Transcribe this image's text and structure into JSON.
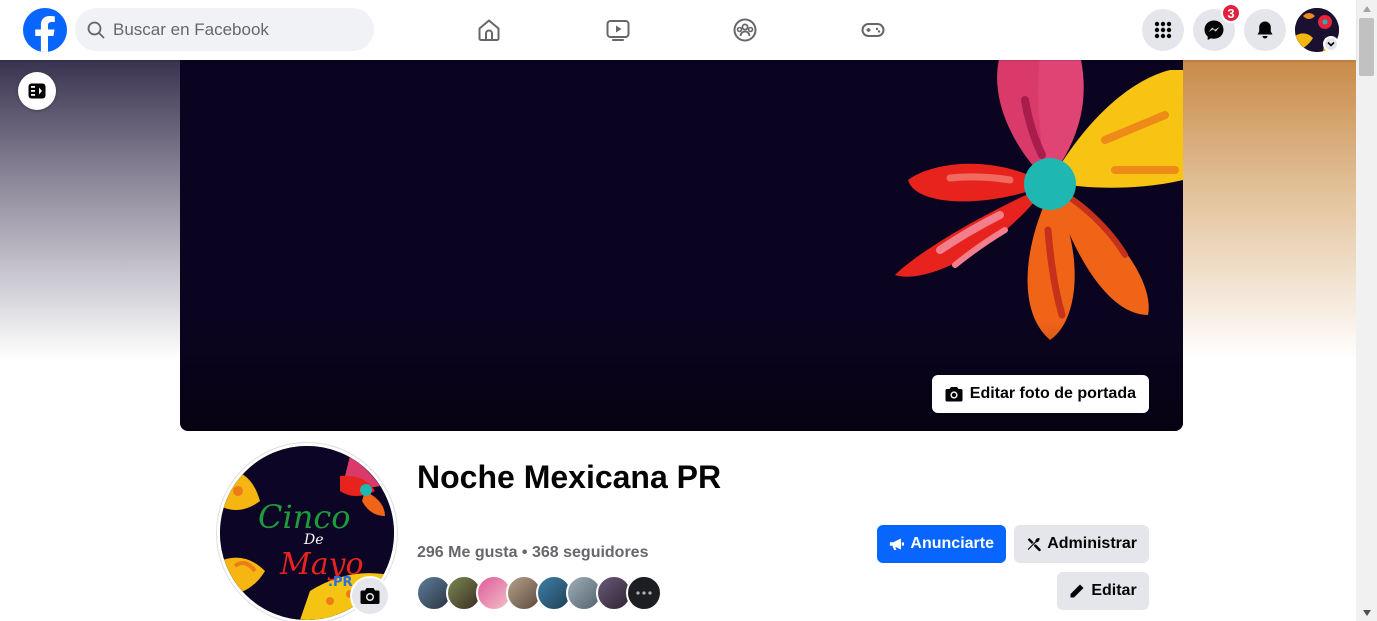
{
  "header": {
    "search": {
      "placeholder": "Buscar en Facebook",
      "value": ""
    },
    "nav_icons": [
      "home-icon",
      "video-icon",
      "groups-icon",
      "gaming-icon"
    ],
    "messenger_badge": "3"
  },
  "cover": {
    "edit_cover_label": "Editar foto de portada"
  },
  "page": {
    "name": "Noche Mexicana PR",
    "stats": "296 Me gusta • 368 seguidores",
    "profile_pic_lettering": {
      "line1": "Cinco",
      "line2": "De",
      "line3": "Mayo",
      "line4": ".PR"
    }
  },
  "actions": {
    "promote_label": "Anunciarte",
    "manage_label": "Administrar",
    "edit_label": "Editar"
  },
  "colors": {
    "brand_blue": "#0866ff",
    "badge_red": "#e41e3f",
    "cover_bg": "#0b0420"
  }
}
